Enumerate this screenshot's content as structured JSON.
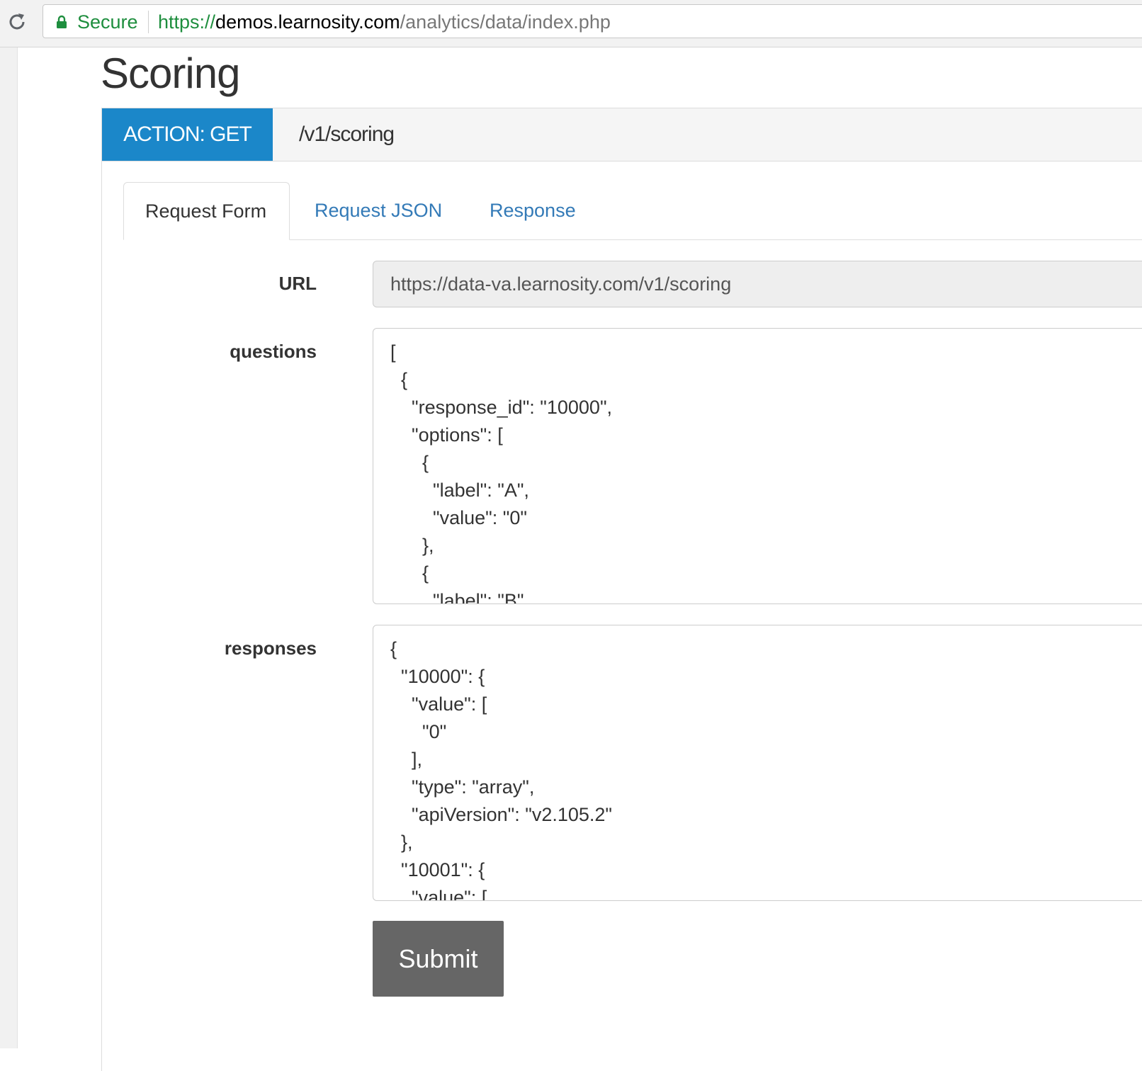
{
  "browser": {
    "secure_label": "Secure",
    "url_scheme": "https://",
    "url_host": "demos.learnosity.com",
    "url_path": "/analytics/data/index.php",
    "secure_color": "#1e8e3e"
  },
  "page": {
    "title": "Scoring"
  },
  "endpoint": {
    "action_label": "ACTION: GET",
    "action_color": "#1b87c9",
    "path": "/v1/scoring"
  },
  "tabs": [
    {
      "label": "Request Form",
      "active": true
    },
    {
      "label": "Request JSON",
      "active": false
    },
    {
      "label": "Response",
      "active": false
    }
  ],
  "form": {
    "url": {
      "label": "URL",
      "value": "https://data-va.learnosity.com/v1/scoring"
    },
    "questions": {
      "label": "questions",
      "value": "[\n  {\n    \"response_id\": \"10000\",\n    \"options\": [\n      {\n        \"label\": \"A\",\n        \"value\": \"0\"\n      },\n      {\n        \"label\": \"B\""
    },
    "responses": {
      "label": "responses",
      "value": "{\n  \"10000\": {\n    \"value\": [\n      \"0\"\n    ],\n    \"type\": \"array\",\n    \"apiVersion\": \"v2.105.2\"\n  },\n  \"10001\": {\n    \"value\": ["
    },
    "submit_label": "Submit"
  }
}
